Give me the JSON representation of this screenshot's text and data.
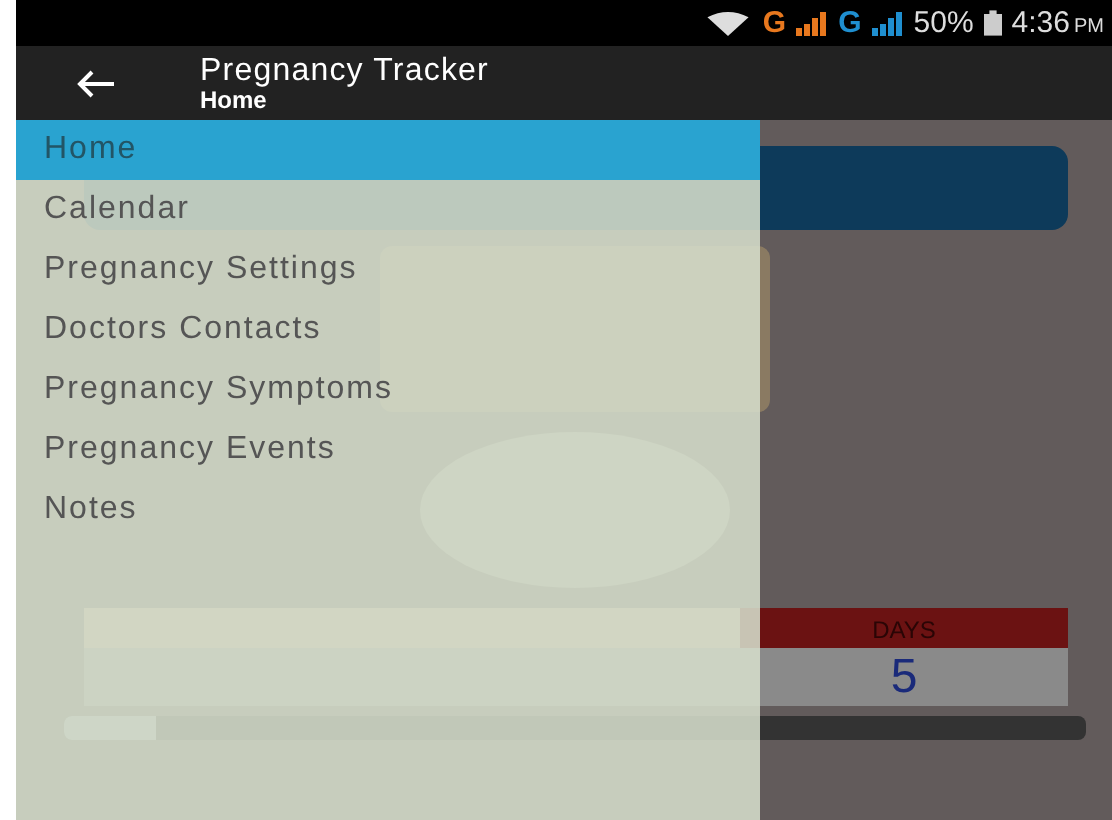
{
  "status_bar": {
    "network_1": "G",
    "network_2": "G",
    "battery": "50%",
    "time": "4:36",
    "time_suffix": "PM"
  },
  "toolbar": {
    "title": "Pregnancy Tracker",
    "subtitle": "Home"
  },
  "drawer": {
    "items": [
      {
        "label": "Home",
        "selected": true
      },
      {
        "label": "Calendar",
        "selected": false
      },
      {
        "label": "Pregnancy Settings",
        "selected": false
      },
      {
        "label": "Doctors Contacts",
        "selected": false
      },
      {
        "label": "Pregnancy Symptoms",
        "selected": false
      },
      {
        "label": "Pregnancy Events",
        "selected": false
      },
      {
        "label": "Notes",
        "selected": false
      }
    ]
  },
  "home": {
    "breakdown": [
      {
        "highlighted": false
      },
      {
        "highlighted": false
      },
      {
        "label": "DAYS",
        "value": "5",
        "highlighted": true
      }
    ],
    "progress": {
      "level": 0.09
    }
  }
}
